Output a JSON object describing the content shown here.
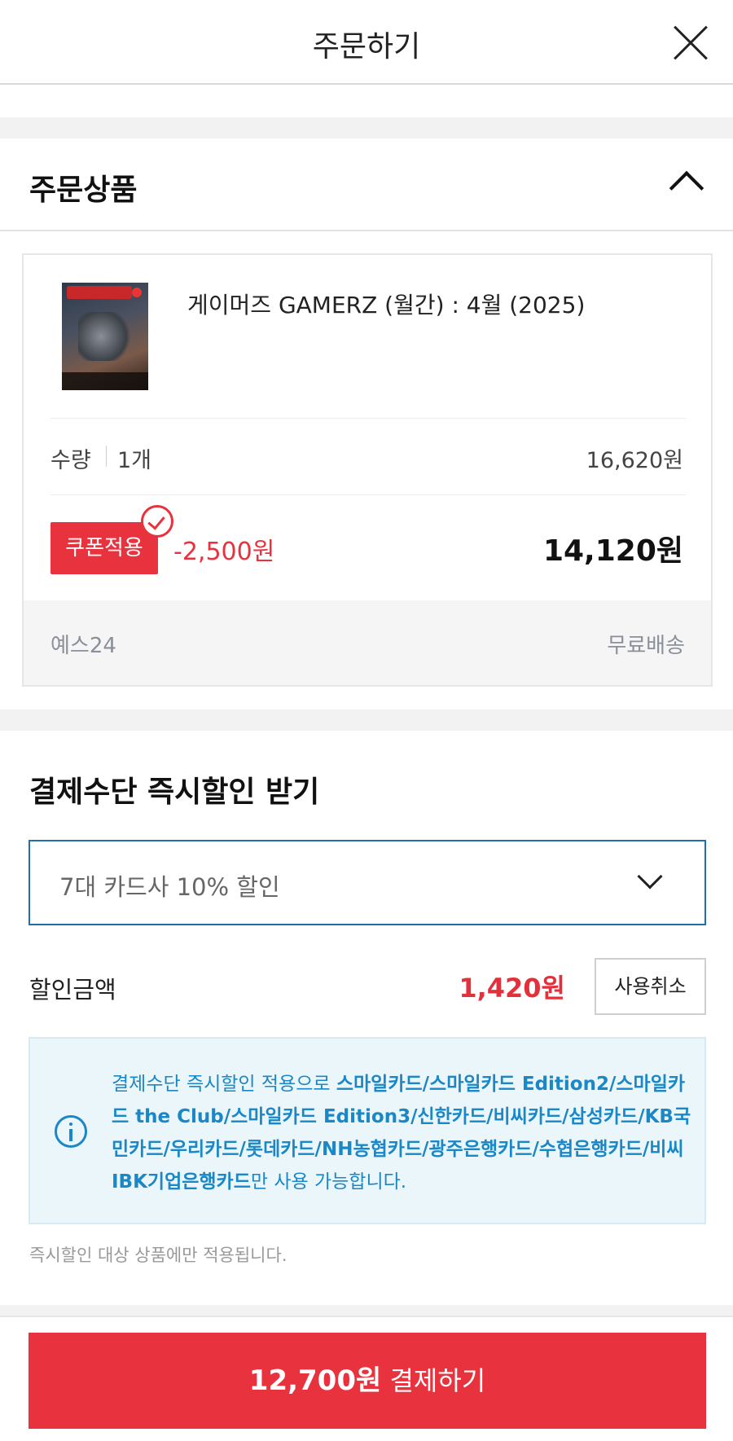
{
  "header": {
    "title": "주문하기"
  },
  "order_section": {
    "title": "주문상품"
  },
  "product": {
    "name": "게이머즈 GAMERZ (월간) : 4월 (2025)",
    "quantity_label": "수량",
    "quantity_value": "1개",
    "unit_price": "16,620원",
    "coupon_badge": "쿠폰적용",
    "coupon_discount": "-2,500원",
    "final_price": "14,120원",
    "seller": "예스24",
    "shipping": "무료배송"
  },
  "payment_discount": {
    "title": "결제수단 즉시할인 받기",
    "selected_option": "7대 카드사 10% 할인",
    "discount_label": "할인금액",
    "discount_amount": "1,420원",
    "cancel_button": "사용취소",
    "info_prefix": "결제수단 즉시할인 적용으로 ",
    "info_cards": "스마일카드/스마일카드 Edition2/스마일카드 the Club/스마일카드 Edition3/신한카드/비씨카드/삼성카드/KB국민카드/우리카드/롯데카드/NH농협카드/광주은행카드/수협은행카드/비씨 IBK기업은행카드",
    "info_suffix": "만 사용 가능합니다.",
    "footnote": "즉시할인 대상 상품에만 적용됩니다."
  },
  "footer": {
    "pay_amount": "12,700원",
    "pay_label": " 결제하기"
  },
  "colors": {
    "accent_red": "#e8323d",
    "info_blue": "#1a87c6",
    "select_border": "#1f6fad"
  }
}
